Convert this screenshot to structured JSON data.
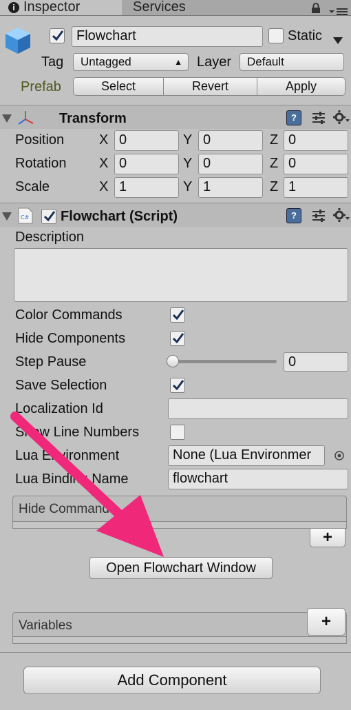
{
  "tabs": {
    "inspector": "Inspector",
    "services": "Services"
  },
  "gameobject": {
    "active_checked": true,
    "name": "Flowchart",
    "static_label": "Static",
    "tag_label": "Tag",
    "tag_value": "Untagged",
    "layer_label": "Layer",
    "layer_value": "Default",
    "prefab_label": "Prefab",
    "prefab_select": "Select",
    "prefab_revert": "Revert",
    "prefab_apply": "Apply"
  },
  "transform": {
    "title": "Transform",
    "rows": [
      {
        "label": "Position",
        "x": "0",
        "y": "0",
        "z": "0"
      },
      {
        "label": "Rotation",
        "x": "0",
        "y": "0",
        "z": "0"
      },
      {
        "label": "Scale",
        "x": "1",
        "y": "1",
        "z": "1"
      }
    ],
    "axis_x": "X",
    "axis_y": "Y",
    "axis_z": "Z"
  },
  "flowchart": {
    "title": "Flowchart (Script)",
    "description_label": "Description",
    "description_value": "",
    "color_commands_label": "Color Commands",
    "hide_components_label": "Hide Components",
    "step_pause_label": "Step Pause",
    "step_pause_value": "0",
    "save_selection_label": "Save Selection",
    "localization_id_label": "Localization Id",
    "localization_id_value": "",
    "show_line_numbers_label": "Show Line Numbers",
    "lua_environment_label": "Lua Environment",
    "lua_environment_value": "None (Lua Environmer",
    "lua_binding_name_label": "Lua Binding Name",
    "lua_binding_name_value": "flowchart",
    "hide_commands_label": "Hide Commands",
    "plus_label": "+",
    "open_window_label": "Open Flowchart Window",
    "variables_label": "Variables"
  },
  "add_component_label": "Add Component",
  "colors": {
    "arrow": "#f0287a",
    "panel": "#c2c2c2",
    "help": "#4a6e9c"
  }
}
